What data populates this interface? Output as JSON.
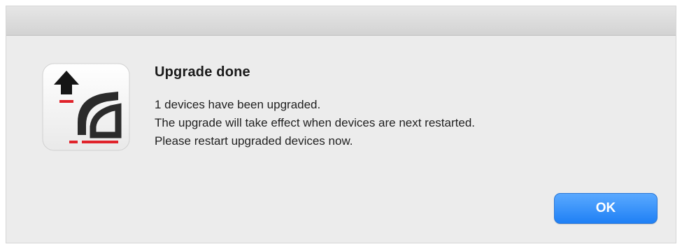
{
  "dialog": {
    "title": "Upgrade done",
    "message_lines": [
      "1 devices have been upgraded.",
      "The upgrade will take effect when devices are next restarted.",
      "Please restart upgraded devices now."
    ],
    "ok_label": "OK",
    "icon": "upgrade-app-icon"
  },
  "colors": {
    "accent": "#2a86f7",
    "icon_red": "#e0232b",
    "dialog_bg": "#ececec"
  }
}
